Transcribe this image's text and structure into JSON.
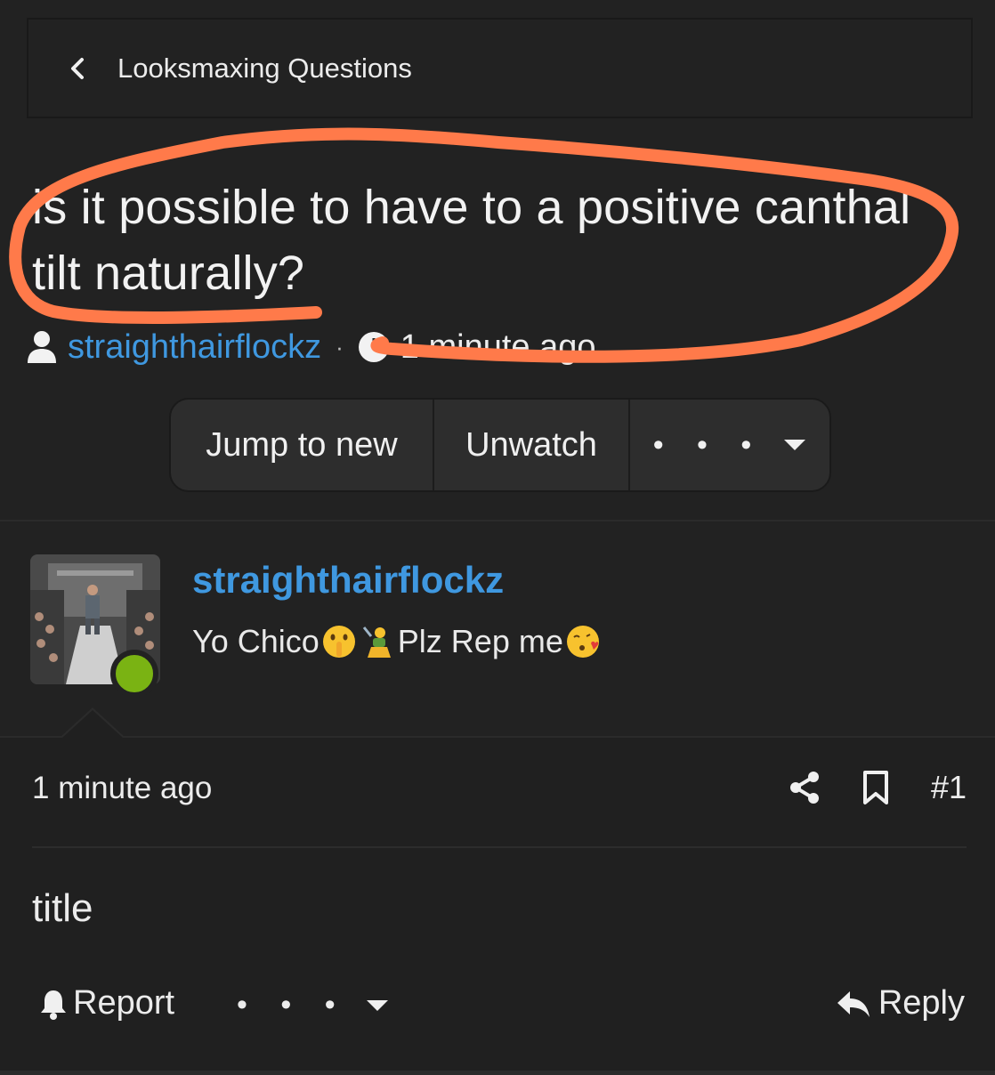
{
  "breadcrumb": {
    "label": "Looksmaxing Questions",
    "icon": "chevron-left-icon"
  },
  "thread": {
    "title": "is it possible to have to a positive canthal tilt naturally?",
    "author": "straighthairflockz",
    "separator": "·",
    "time": "1 minute ago"
  },
  "actions": {
    "jump_to_new": "Jump to new",
    "unwatch": "Unwatch",
    "more": "• • •"
  },
  "poster": {
    "name": "straighthairflockz",
    "sig_part1": "Yo Chico",
    "sig_part2": "Plz Rep me",
    "online": true
  },
  "post": {
    "time": "1 minute ago",
    "number": "#1",
    "content": "title",
    "report_label": "Report",
    "more": "• • •",
    "reply_label": "Reply"
  },
  "colors": {
    "background": "#222222",
    "link": "#3f98e0",
    "online": "#7ab313",
    "annotation": "#ff7a4a"
  }
}
